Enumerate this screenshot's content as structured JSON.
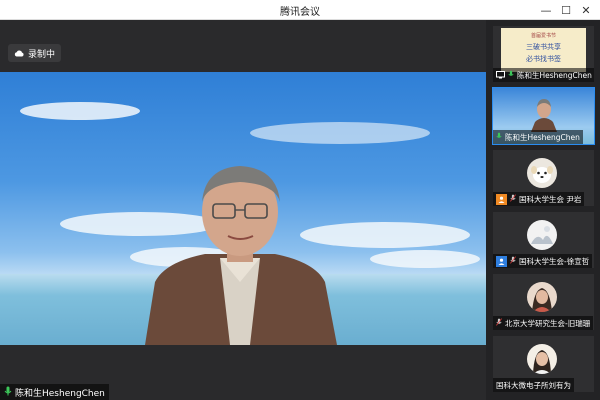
{
  "window": {
    "title": "腾讯会议",
    "min_glyph": "—",
    "max_glyph": "☐",
    "close_glyph": "✕"
  },
  "main": {
    "recording_label": "录制中",
    "speaker_name": "陈和生HeshengChen"
  },
  "sidebar": {
    "participants": [
      {
        "name": "陈和生HeshengChen",
        "content": "shared-document"
      },
      {
        "name": "陈和生HeshengChen",
        "content": "video"
      },
      {
        "name": "国科大学生会 尹岩",
        "content": "avatar"
      },
      {
        "name": "国科大学生会-徐宣哲",
        "content": "avatar"
      },
      {
        "name": "北京大学研究生会-旧瑞珊",
        "content": "avatar"
      },
      {
        "name": "国科大微电子所刘有为",
        "content": "avatar"
      }
    ],
    "shared_doc": {
      "line1": "首届爱书节",
      "line2": "三破书共享",
      "line3": "必书找书签"
    }
  },
  "colors": {
    "accent": "#2a8cf0",
    "mic_green": "#3cc85a",
    "host_orange": "#f08a24",
    "cohost_blue": "#2f7fe0"
  }
}
